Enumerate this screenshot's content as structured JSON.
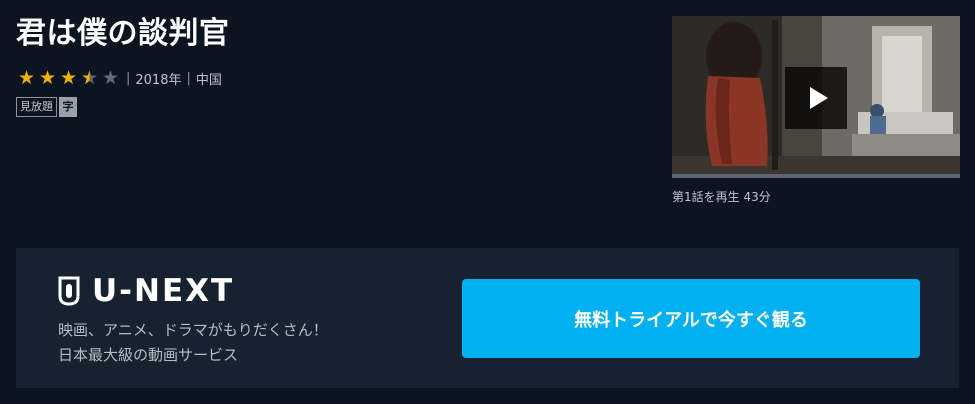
{
  "content": {
    "title": "君は僕の談判官",
    "rating": 3.5,
    "rating_max": 5,
    "year": "2018年",
    "country": "中国",
    "badges": {
      "availability": "見放題",
      "subtitle": "字"
    }
  },
  "player": {
    "play_icon": "play-icon",
    "episode_info": "第1話を再生 43分"
  },
  "promo": {
    "brand_name": "U-NEXT",
    "brand_icon": "shield-logo-icon",
    "tagline_line1": "映画、アニメ、ドラマがもりだくさん！",
    "tagline_line2": "日本最大級の動画サービス",
    "cta_label": "無料トライアルで今すぐ観る"
  },
  "colors": {
    "background": "#0b1420",
    "promo_background": "#172230",
    "cta": "#00b0f0",
    "star": "#f5b301"
  }
}
